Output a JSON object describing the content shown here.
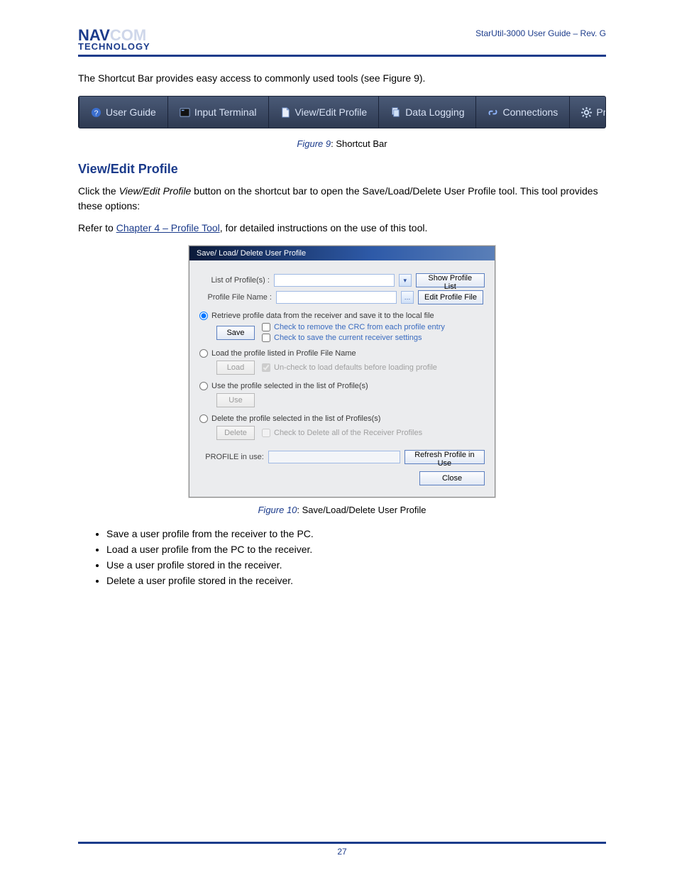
{
  "header": {
    "logo_line1_a": "NAV",
    "logo_line1_b": "COM",
    "logo_line2": "TECHNOLOGY",
    "doc_title": "StarUtil-3000 User Guide – Rev. G"
  },
  "intro": "The Shortcut Bar provides easy access to commonly used tools (see Figure 9).",
  "shortcut_items": [
    {
      "icon": "help-circle-icon",
      "label": "User Guide"
    },
    {
      "icon": "terminal-icon",
      "label": "Input Terminal"
    },
    {
      "icon": "file-icon",
      "label": "View/Edit Profile"
    },
    {
      "icon": "copy-icon",
      "label": "Data Logging"
    },
    {
      "icon": "link-icon",
      "label": "Connections"
    },
    {
      "icon": "gear-icon",
      "label": "Preferences"
    }
  ],
  "fig9_num": "Figure 9",
  "fig9_text": ": Shortcut Bar",
  "h_ve": "View/Edit Profile",
  "ve_p1a": "Click the ",
  "ve_p1b": "View/Edit Profile",
  "ve_p1c": " button on the shortcut bar to open the Save/Load/Delete User Profile tool. This tool provides these options:",
  "ve_p2a": "Refer to ",
  "ve_link": "Chapter 4 – Profile Tool",
  "ve_p2b": ", for detailed instructions on the use of this tool.",
  "dialog": {
    "title": "Save/ Load/ Delete User Profile",
    "lbl_list": "List of Profile(s) :",
    "lbl_name": "Profile File Name :",
    "btn_showlist": "Show Profile List",
    "btn_editfile": "Edit Profile File",
    "opt_retrieve": "Retrieve profile data from the receiver and save it to the local file",
    "btn_save": "Save",
    "chk_removecrc": "Check to remove the CRC from each profile entry",
    "chk_savecurrent": "Check to save the current receiver settings",
    "opt_load": "Load the profile listed in Profile File Name",
    "btn_load": "Load",
    "chk_uncheck": "Un-check to load defaults before loading profile",
    "opt_use": "Use the profile selected in the list of Profile(s)",
    "btn_use": "Use",
    "opt_delete": "Delete the profile selected in the list of Profiles(s)",
    "btn_delete": "Delete",
    "chk_deleteall": "Check to Delete all of the Receiver Profiles",
    "lbl_inuse": "PROFILE in use:",
    "btn_refresh": "Refresh Profile in Use",
    "btn_close": "Close"
  },
  "fig10_num": "Figure 10",
  "fig10_text": ": Save/Load/Delete User Profile",
  "bullets": [
    "Save a user profile from the receiver to the PC.",
    "Load a user profile from the PC to the receiver.",
    "Use a user profile stored in the receiver.",
    "Delete a user profile stored in the receiver."
  ],
  "page_number": "27"
}
